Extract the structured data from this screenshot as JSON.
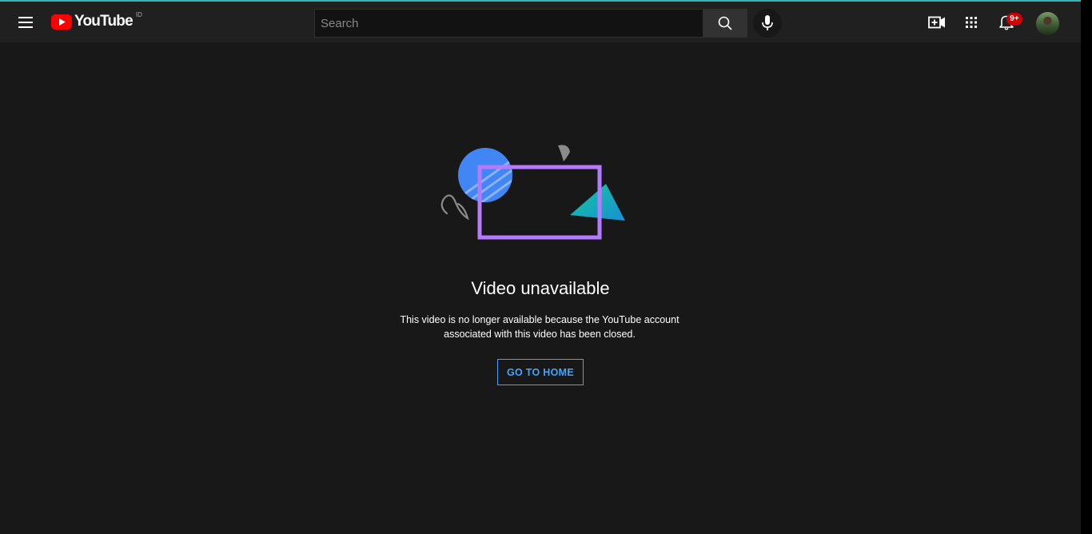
{
  "header": {
    "logo_text": "YouTube",
    "region": "ID",
    "search_placeholder": "Search",
    "notification_badge": "9+"
  },
  "error": {
    "title": "Video unavailable",
    "message_line1": "This video is no longer available because the YouTube account",
    "message_line2": "associated with this video has been closed.",
    "button_label": "GO TO HOME"
  },
  "icons": {
    "menu": "hamburger-menu-icon",
    "logo": "youtube-logo-icon",
    "search": "search-icon",
    "mic": "microphone-icon",
    "create": "create-video-icon",
    "apps": "apps-grid-icon",
    "notifications": "bell-icon"
  },
  "colors": {
    "background": "#181818",
    "header": "#202020",
    "accent_link": "#3ea6ff",
    "brand_red": "#ff0000",
    "badge": "#cc0000",
    "illustration_purple": "#b57bff",
    "illustration_blue": "#4285f4",
    "illustration_teal": "#12b5a0"
  }
}
